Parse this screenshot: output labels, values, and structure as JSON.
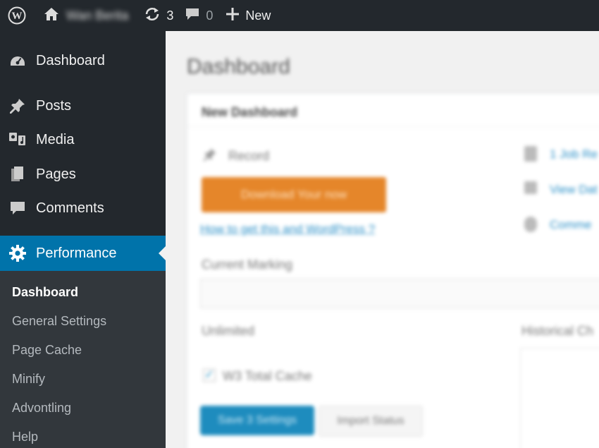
{
  "admin_bar": {
    "site_name": "Wan Berita",
    "updates_count": "3",
    "comments_count": "0",
    "new_label": "New"
  },
  "sidebar": {
    "items": [
      {
        "label": "Dashboard",
        "icon": "dashboard-icon"
      },
      {
        "label": "Posts",
        "icon": "pin-icon"
      },
      {
        "label": "Media",
        "icon": "media-icon"
      },
      {
        "label": "Pages",
        "icon": "pages-icon"
      },
      {
        "label": "Comments",
        "icon": "comment-icon"
      },
      {
        "label": "Performance",
        "icon": "gear-icon",
        "active": true
      }
    ],
    "submenu": [
      {
        "label": "Dashboard",
        "current": true
      },
      {
        "label": "General Settings"
      },
      {
        "label": "Page Cache"
      },
      {
        "label": "Minify"
      },
      {
        "label": "Advontling"
      },
      {
        "label": "Help"
      }
    ]
  },
  "main": {
    "title": "Dashboard",
    "panel_title": "New Dashboard",
    "record_label": "Record",
    "download_button": "Download Your now",
    "help_link": "How to get this and WordPress ?",
    "current_label": "Current Marking",
    "unlimited_label": "Unlimited",
    "history_label": "Historical Ch",
    "checkbox_label": "W3 Total Cache",
    "save_button": "Save 3 Settings",
    "import_button": "Import Status",
    "right_links": [
      "1 Job Re",
      "View Dat",
      "Comme"
    ]
  },
  "colors": {
    "admin_bar_bg": "#23282d",
    "sidebar_bg": "#23282d",
    "submenu_bg": "#32373c",
    "active_bg": "#0073aa",
    "download_button_bg": "#e5862a",
    "save_button_bg": "#1e8cbe"
  }
}
